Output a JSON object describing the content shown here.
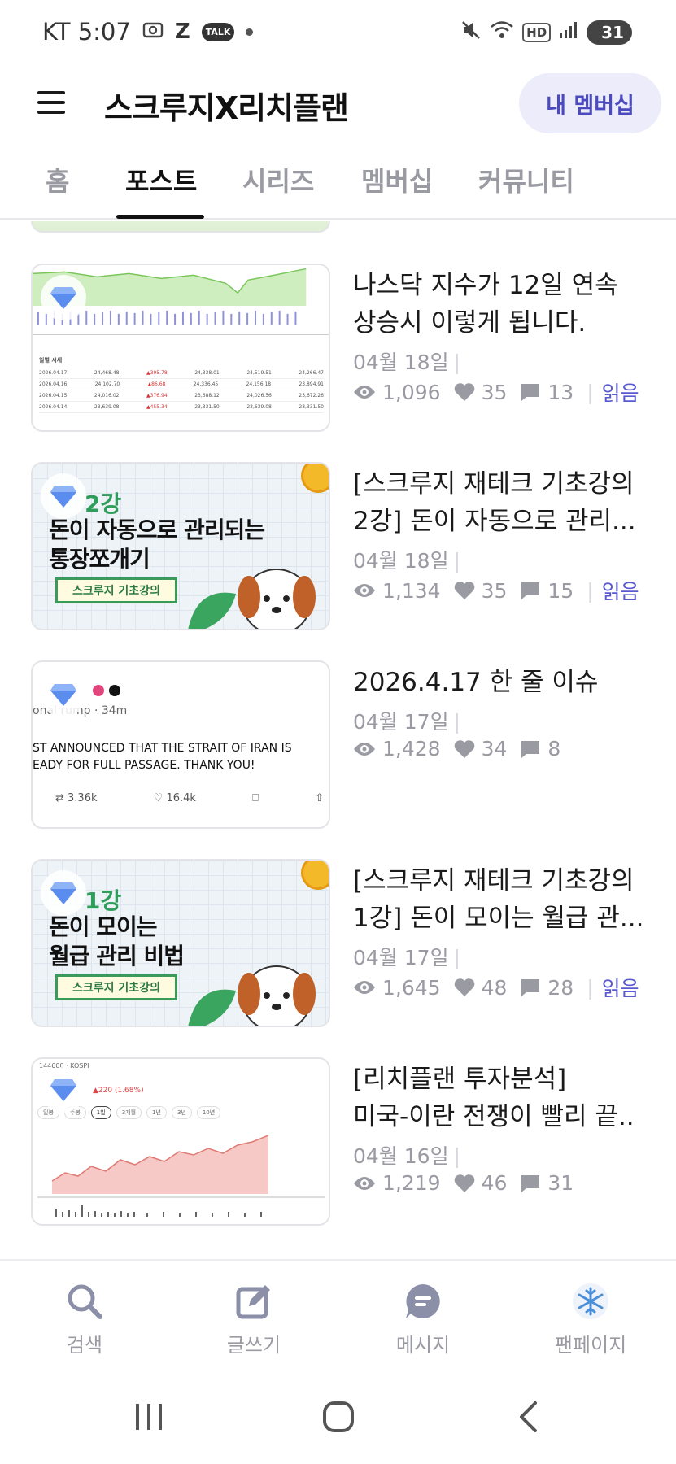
{
  "status_bar": {
    "carrier_time": "KT 5:07",
    "talk_badge": "TALK",
    "hd": "HD",
    "battery": "31"
  },
  "app_bar": {
    "title": "스크루지X리치플랜",
    "membership_button": "내 멤버십"
  },
  "tabs": [
    {
      "label": "홈",
      "active": false
    },
    {
      "label": "포스트",
      "active": true
    },
    {
      "label": "시리즈",
      "active": false
    },
    {
      "label": "멤버십",
      "active": false
    },
    {
      "label": "커뮤니티",
      "active": false
    }
  ],
  "posts": [
    {
      "title_line1": "나스닥 지수가 12일 연속",
      "title_line2": "상승시 이렇게 됩니다.",
      "date": "04월 18일",
      "views": "1,096",
      "likes": "35",
      "comments": "13",
      "read": "읽음",
      "thumb": {
        "table_title": "일별 시세",
        "rows": [
          [
            "2026.04.17",
            "24,468.48",
            "▲395.78",
            "24,338.01",
            "24,519.51",
            "24,266.47"
          ],
          [
            "2026.04.16",
            "24,102.70",
            "▲86.68",
            "24,336.45",
            "24,156.18",
            "23,894.91"
          ],
          [
            "2026.04.15",
            "24,016.02",
            "▲376.94",
            "23,688.12",
            "24,026.56",
            "23,672.26"
          ],
          [
            "2026.04.14",
            "23,639.08",
            "▲455.34",
            "23,331.50",
            "23,639.08",
            "23,331.50"
          ]
        ]
      }
    },
    {
      "title_line1": "[스크루지 재테크 기초강의",
      "title_line2": "2강] 돈이 자동으로 관리...",
      "date": "04월 18일",
      "views": "1,134",
      "likes": "35",
      "comments": "15",
      "read": "읽음",
      "thumb": {
        "num": "2강",
        "head_line1": "돈이 자동으로 관리되는",
        "head_line2": "통장쪼개기",
        "badge": "스크루지 기초강의"
      }
    },
    {
      "title_line1": "2026.4.17 한 줄 이슈",
      "title_line2": "",
      "date": "04월 17일",
      "views": "1,428",
      "likes": "34",
      "comments": "8",
      "read": "",
      "thumb": {
        "handle": "onal  rump · 34m",
        "text_line1": "ST ANNOUNCED THAT THE STRAIT OF IRAN IS",
        "text_line2": "EADY FOR FULL PASSAGE. THANK YOU!",
        "retweets": "3.36k",
        "tweet_likes": "16.4k"
      }
    },
    {
      "title_line1": "[스크루지 재테크 기초강의",
      "title_line2": "1강] 돈이 모이는 월급 관...",
      "date": "04월 17일",
      "views": "1,645",
      "likes": "48",
      "comments": "28",
      "read": "읽음",
      "thumb": {
        "num": "1강",
        "head_line1": "돈이 모이는",
        "head_line2": "월급 관리 비법",
        "badge": "스크루지 기초강의"
      }
    },
    {
      "title_line1": "[리치플랜 투자분석]",
      "title_line2": "미국-이란 전쟁이 빨리 끝..",
      "date": "04월 16일",
      "views": "1,219",
      "likes": "46",
      "comments": "31",
      "read": "",
      "thumb": {
        "label": "144600 · KOSPI",
        "change": "▲220 (1.68%)",
        "periods": [
          "일봉",
          "주봉",
          "1일",
          "3개월",
          "1년",
          "3년",
          "10년"
        ]
      }
    }
  ],
  "bottom_nav": [
    {
      "label": "검색",
      "icon": "search-icon"
    },
    {
      "label": "글쓰기",
      "icon": "edit-icon"
    },
    {
      "label": "메시지",
      "icon": "message-icon"
    },
    {
      "label": "팬페이지",
      "icon": "snowflake-icon"
    }
  ],
  "colors": {
    "accent": "#5a5ad0",
    "membership_bg": "#ececfa",
    "muted": "#9a9aa3",
    "green": "#2e9e5a"
  }
}
